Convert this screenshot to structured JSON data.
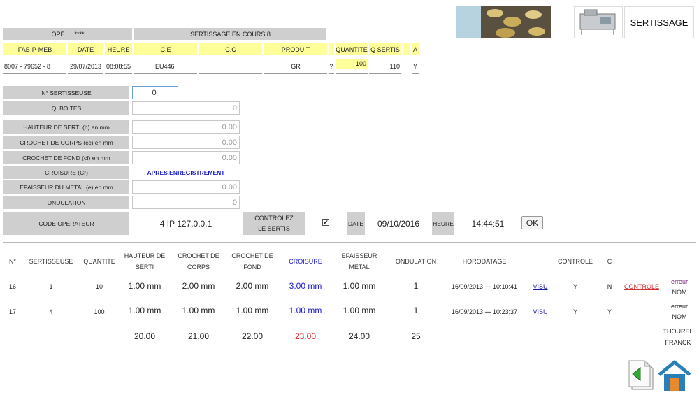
{
  "banner": {
    "title": "SERTISSAGE"
  },
  "top": {
    "ope_label": "OPE",
    "ope_value": "****",
    "status": "SERTISSAGE EN COURS 8",
    "headers": [
      "FAB-P-MEB",
      "DATE",
      "HEURE",
      "C.E",
      "C.C",
      "PRODUIT",
      "QUANTITE",
      "Q SERTIS",
      "A"
    ],
    "row": {
      "fab": "8007 - 79652 - 8",
      "date": "29/07/2013",
      "heure": "08:08:55",
      "ce": "EU446",
      "cc": "",
      "produit": "GR",
      "q_mark": "?",
      "quantite": "100",
      "q_sertis": "110",
      "a": "Y"
    }
  },
  "form": {
    "sertisseuse_label": "N° SERTISSEUSE",
    "sertisseuse_value": "0",
    "boites_label": "Q. BOITES",
    "boites_value": "0",
    "hauteur_label": "HAUTEUR DE SERTI (h) en mm",
    "hauteur_value": "0.00",
    "corps_label": "CROCHET DE CORPS (cc) en mm",
    "corps_value": "0.00",
    "fond_label": "CROCHET DE FOND (cf) en mm",
    "fond_value": "0.00",
    "croisure_label": "CROISURE (Cr)",
    "croisure_value": "APRES ENREGISTREMENT",
    "epaisseur_label": "EPAISSEUR DU METAL (e) en mm",
    "epaisseur_value": "0.00",
    "ondulation_label": "ONDULATION",
    "ondulation_value": "0",
    "operateur_label": "CODE OPERATEUR",
    "operateur_value": "4 IP 127.0.0.1",
    "controlez_label_1": "CONTROLEZ",
    "controlez_label_2": "LE SERTIS",
    "date_label": "DATE",
    "date_value": "09/10/2016",
    "heure_label": "HEURE",
    "heure_value": "14:44:51",
    "ok_label": "OK"
  },
  "table": {
    "headers": {
      "n": "N°",
      "sertisseuse": "SERTISSEUSE",
      "quantite": "QUANTITE",
      "hauteur_1": "HAUTEUR DE",
      "hauteur_2": "SERTI",
      "corps_1": "CROCHET DE",
      "corps_2": "CORPS",
      "fond_1": "CROCHET DE",
      "fond_2": "FOND",
      "croisure": "CROISURE",
      "epaisseur_1": "EPAISSEUR",
      "epaisseur_2": "METAL",
      "ondulation": "ONDULATION",
      "horodatage": "HORODATAGE",
      "controle": "CONTROLE",
      "c": "C"
    },
    "rows": [
      {
        "n": "16",
        "sertisseuse": "1",
        "quantite": "10",
        "hauteur": "1.00 mm",
        "corps": "2.00 mm",
        "fond": "2.00 mm",
        "croisure": "3.00 mm",
        "epaisseur": "1.00 mm",
        "ondulation": "1",
        "horodatage": "16/09/2013 --- 10:10:41",
        "visu": "VISU",
        "controle": "Y",
        "c": "N",
        "controle_link": "CONTROLE",
        "note_1": "erreur",
        "note_2": "NOM"
      },
      {
        "n": "17",
        "sertisseuse": "4",
        "quantite": "100",
        "hauteur": "1.00 mm",
        "corps": "1.00 mm",
        "fond": "1.00 mm",
        "croisure": "1.00 mm",
        "epaisseur": "1.00 mm",
        "ondulation": "1",
        "horodatage": "16/09/2013 --- 10:23:37",
        "visu": "VISU",
        "controle": "Y",
        "c": "Y",
        "controle_link": "",
        "note_1": "erreur",
        "note_2": "NOM"
      }
    ],
    "ref": {
      "hauteur": "20.00",
      "corps": "21.00",
      "fond": "22.00",
      "croisure": "23.00",
      "epaisseur": "24.00",
      "ondulation": "25",
      "name_1": "THOUREL",
      "name_2": "FRANCK"
    }
  },
  "colors": {
    "gray": "#cfcfcf",
    "yellow": "#ffff99",
    "blue": "#1a1acc",
    "red": "#e02020"
  }
}
